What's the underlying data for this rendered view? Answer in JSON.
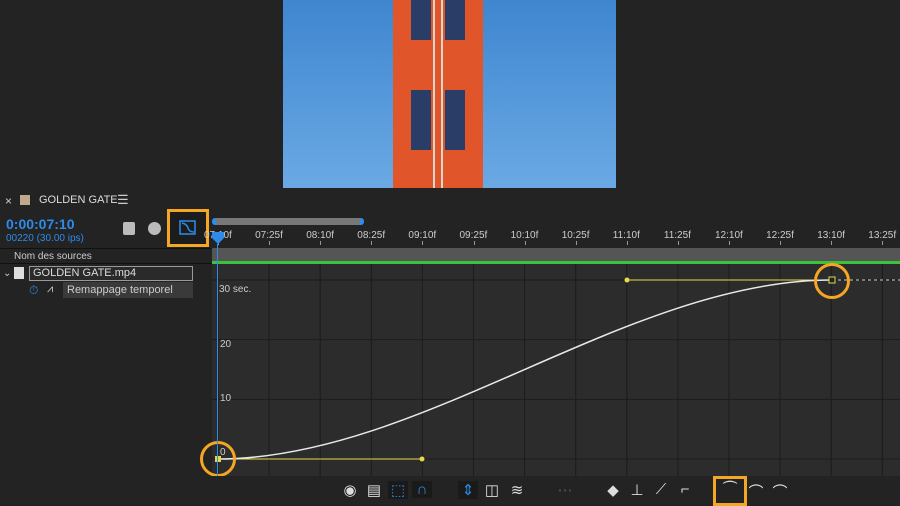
{
  "composition": {
    "name": "GOLDEN GATE",
    "timecode": "0:00:07:10",
    "frame_info": "00220 (30.00 ips)"
  },
  "layers": {
    "column_header": "Nom des sources",
    "layer_name": "GOLDEN GATE.mp4",
    "property": "Remappage temporel"
  },
  "ruler": {
    "labels": [
      "07:10f",
      "07:25f",
      "08:10f",
      "08:25f",
      "09:10f",
      "09:25f",
      "10:10f",
      "10:25f",
      "11:10f",
      "11:25f",
      "12:10f",
      "12:25f",
      "13:10f",
      "13:25f"
    ]
  },
  "graph": {
    "y_labels": [
      "30 sec.",
      "20",
      "10",
      "0"
    ],
    "curve_color": "#e8e8e8",
    "handle_color": "#e6d84a",
    "keyframes": [
      {
        "time": "07:10f",
        "value_sec": 0
      },
      {
        "time": "13:10f",
        "value_sec": 30
      }
    ]
  },
  "toolbar": {
    "icons": [
      "eye-icon",
      "graph-options-icon",
      "transform-box-icon",
      "snap-icon",
      "fit-view-icon",
      "fit-selection-icon",
      "fit-all-icon",
      "separate-dimensions-icon",
      "edit-keyframe-icon",
      "hold-icon",
      "linear-icon",
      "auto-bezier-icon",
      "easy-ease-icon",
      "easy-ease-in-icon",
      "easy-ease-out-icon"
    ]
  },
  "colors": {
    "accent": "#2d8ceb",
    "highlight": "#f5a623",
    "work_area": "#3bc43b"
  }
}
